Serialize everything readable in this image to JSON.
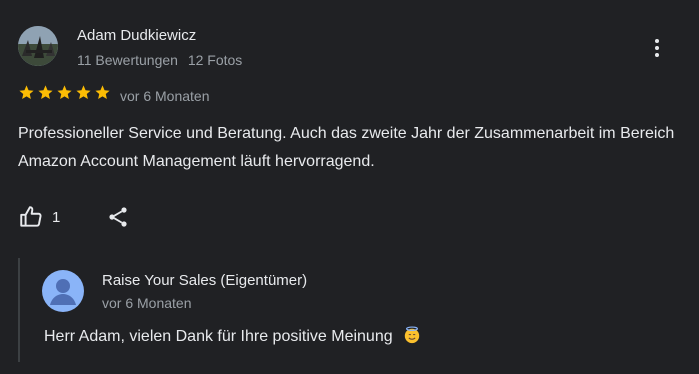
{
  "review": {
    "author_name": "Adam Dudkiewicz",
    "review_count": "11 Bewertungen",
    "photo_count": "12 Fotos",
    "rating": 5,
    "date": "vor 6 Monaten",
    "text": "Professioneller Service und Beratung. Auch das zweite Jahr der Zusammenarbeit im Bereich Amazon Account Management läuft hervorragend.",
    "likes": "1",
    "icons": {
      "more": "more-vert-icon",
      "like": "thumb-up-icon",
      "share": "share-icon"
    },
    "colors": {
      "star": "#fbbc04",
      "background": "#202124",
      "text": "#e8eaed",
      "muted": "#9aa0a6"
    }
  },
  "owner_reply": {
    "name": "Raise Your Sales (Eigentümer)",
    "date": "vor 6 Monaten",
    "text": "Herr Adam, vielen Dank für Ihre positive Meinung",
    "emoji_icon": "smiling-face-with-halo-icon",
    "avatar_color": "#8ab4f8"
  }
}
